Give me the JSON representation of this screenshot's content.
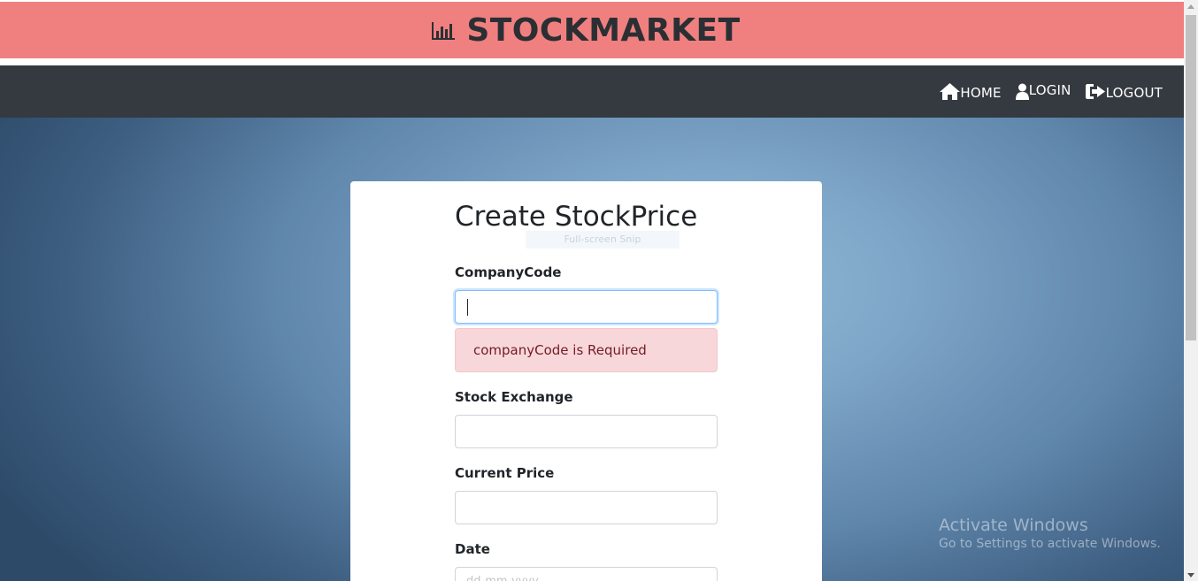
{
  "header": {
    "brand_icon": "bar-chart-icon",
    "brand_title": "STOCKMARKET",
    "banner_color": "#f08080"
  },
  "navbar": {
    "background": "#343a40",
    "links": [
      {
        "label": "HOME",
        "icon": "home-icon"
      },
      {
        "label": "LOGIN",
        "icon": "user-icon"
      },
      {
        "label": "LOGOUT",
        "icon": "sign-out-icon"
      }
    ]
  },
  "form": {
    "title": "Create StockPrice",
    "snip_overlay": "Full-screen Snip",
    "fields": [
      {
        "label": "CompanyCode",
        "value": "",
        "error": "companyCode is Required"
      },
      {
        "label": "Stock Exchange",
        "value": ""
      },
      {
        "label": "Current Price",
        "value": ""
      },
      {
        "label": "Date",
        "placeholder": "dd-mm-yyyy"
      }
    ]
  },
  "watermark": {
    "title": "Activate Windows",
    "subtitle": "Go to Settings to activate Windows."
  }
}
